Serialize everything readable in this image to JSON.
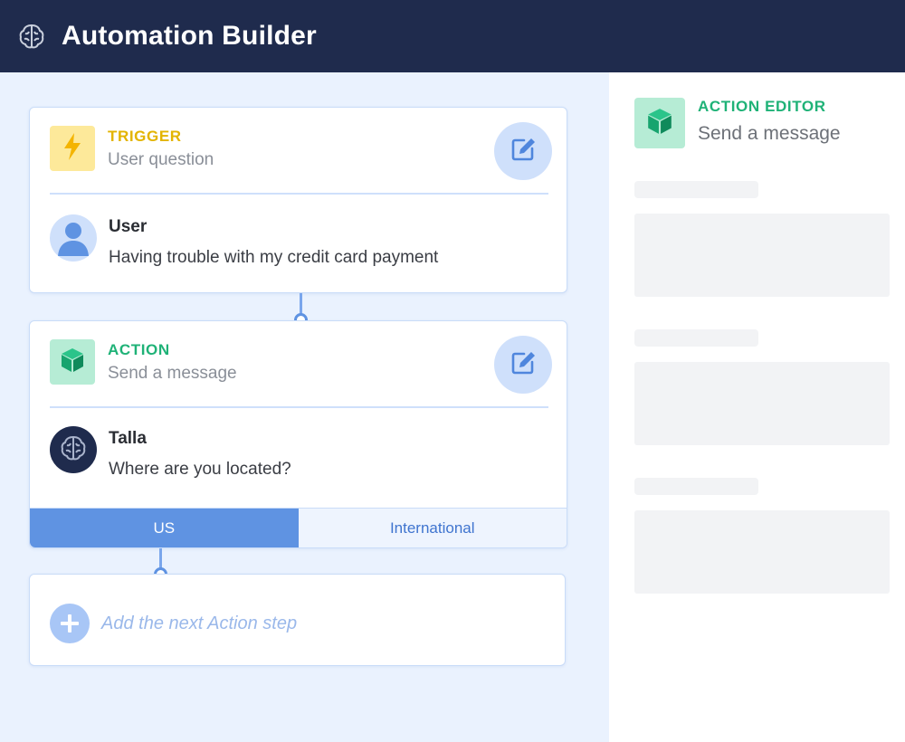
{
  "app": {
    "title": "Automation Builder",
    "logo_icon": "brain-icon"
  },
  "colors": {
    "header_bg": "#1f2b4d",
    "canvas_bg": "#eaf2fe",
    "trigger_accent": "#e3b400",
    "action_accent": "#1fb277",
    "primary_blue": "#5f93e2"
  },
  "trigger": {
    "type_label": "TRIGGER",
    "subtitle": "User question",
    "icon": "lightning-icon",
    "edit_icon": "edit-icon",
    "message": {
      "sender": "User",
      "text": "Having trouble with my credit card payment",
      "avatar_icon": "user-icon"
    }
  },
  "action": {
    "type_label": "ACTION",
    "subtitle": "Send a message",
    "icon": "cube-icon",
    "edit_icon": "edit-icon",
    "message": {
      "sender": "Talla",
      "text": "Where are you located?",
      "avatar_icon": "brain-icon"
    },
    "choices": [
      {
        "label": "US",
        "selected": true
      },
      {
        "label": "International",
        "selected": false
      }
    ]
  },
  "add_step": {
    "label": "Add the next Action step",
    "icon": "plus-icon"
  },
  "editor": {
    "type_label": "ACTION EDITOR",
    "subtitle": "Send a message",
    "icon": "cube-icon"
  }
}
